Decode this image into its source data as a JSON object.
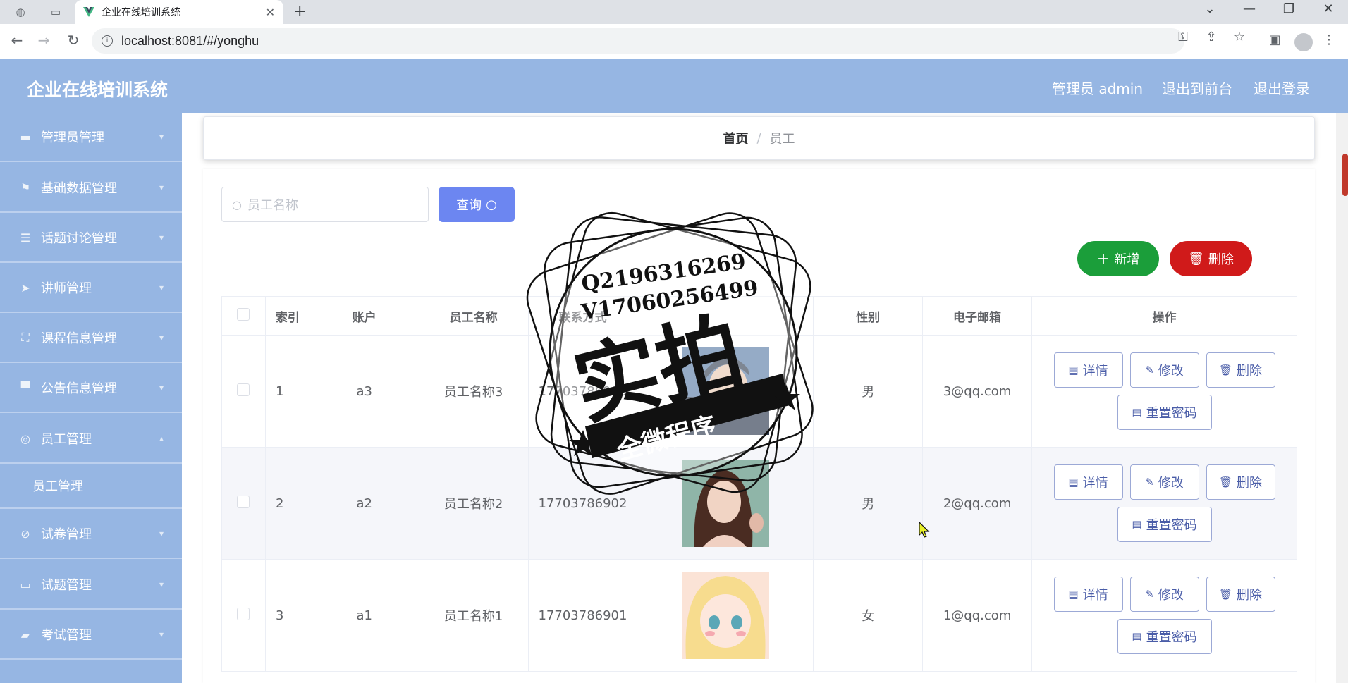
{
  "browser": {
    "tab_title": "企业在线培训系统",
    "url": "localhost:8081/#/yonghu"
  },
  "header": {
    "app_title": "企业在线培训系统",
    "admin_label": "管理员 admin",
    "to_front_label": "退出到前台",
    "logout_label": "退出登录"
  },
  "sidebar": {
    "items": [
      {
        "label": "管理员管理",
        "icon": "briefcase-icon"
      },
      {
        "label": "基础数据管理",
        "icon": "flag-icon"
      },
      {
        "label": "话题讨论管理",
        "icon": "sliders-icon"
      },
      {
        "label": "讲师管理",
        "icon": "send-icon"
      },
      {
        "label": "课程信息管理",
        "icon": "fullscreen-icon"
      },
      {
        "label": "公告信息管理",
        "icon": "laptop-icon"
      },
      {
        "label": "员工管理",
        "icon": "globe-icon"
      },
      {
        "label": "试卷管理",
        "icon": "compass-icon"
      },
      {
        "label": "试题管理",
        "icon": "chat-icon"
      },
      {
        "label": "考试管理",
        "icon": "brush-icon"
      }
    ],
    "sub_item": "员工管理"
  },
  "breadcrumb": {
    "home": "首页",
    "separator": "/",
    "current": "员工"
  },
  "search": {
    "placeholder": "员工名称",
    "query_label": "查询"
  },
  "actions": {
    "add_label": "新增",
    "delete_label": "删除"
  },
  "table": {
    "headers": [
      "索引",
      "账户",
      "员工名称",
      "联系方式",
      "",
      "性别",
      "电子邮箱",
      "操作"
    ],
    "rows": [
      {
        "index": "1",
        "account": "a3",
        "name": "员工名称3",
        "phone": "17703786903",
        "gender": "男",
        "email": "3@qq.com"
      },
      {
        "index": "2",
        "account": "a2",
        "name": "员工名称2",
        "phone": "17703786902",
        "gender": "男",
        "email": "2@qq.com"
      },
      {
        "index": "3",
        "account": "a1",
        "name": "员工名称1",
        "phone": "17703786901",
        "gender": "女",
        "email": "1@qq.com"
      }
    ],
    "op_detail": "详情",
    "op_edit": "修改",
    "op_delete": "删除",
    "op_reset": "重置密码"
  },
  "watermark": {
    "line1": "Q2196316269",
    "line2": "V17060256499",
    "big": "实拍",
    "banner": "全微程序"
  },
  "colors": {
    "header_bg": "#96b6e3",
    "query_btn": "#6c86f1",
    "add_btn": "#1b9e3a",
    "delete_btn": "#d01a1a"
  }
}
